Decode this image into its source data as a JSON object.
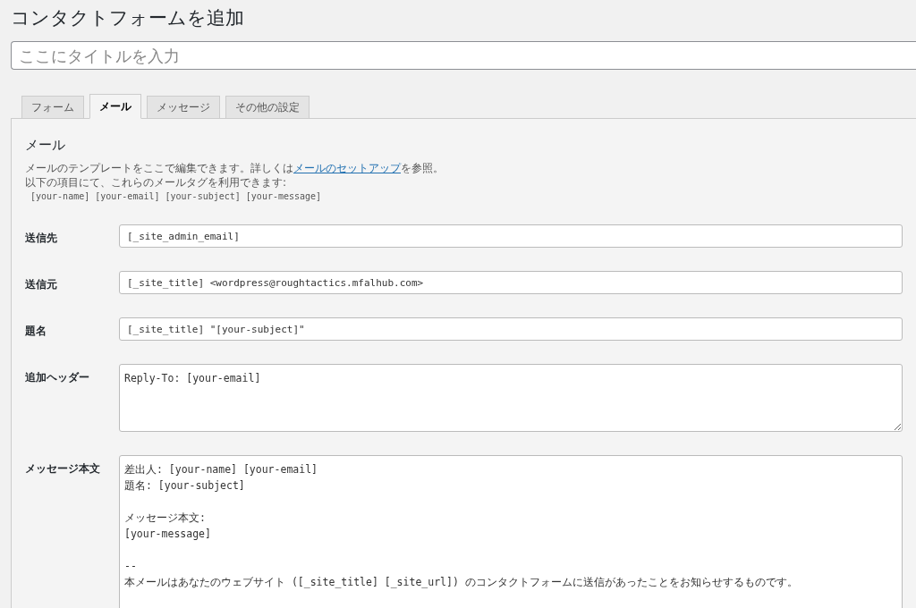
{
  "page_title": "コンタクトフォームを追加",
  "title_field": {
    "placeholder": "ここにタイトルを入力"
  },
  "tabs": [
    {
      "label": "フォーム",
      "selected": false
    },
    {
      "label": "メール",
      "selected": true
    },
    {
      "label": "メッセージ",
      "selected": false
    },
    {
      "label": "その他の設定",
      "selected": false
    }
  ],
  "section": {
    "heading": "メール",
    "description_before": "メールのテンプレートをここで編集できます。詳しくは",
    "link": "メールのセットアップ",
    "description_after": "を参照。",
    "tags_intro": "以下の項目にて、これらのメールタグを利用できます:",
    "tags": "[your-name] [your-email] [your-subject] [your-message]"
  },
  "fields": [
    {
      "kind": "input",
      "label": "送信先",
      "value": "[_site_admin_email]"
    },
    {
      "kind": "input",
      "label": "送信元",
      "value": "[_site_title] <wordpress@roughtactics.mfalhub.com>"
    },
    {
      "kind": "input",
      "label": "題名",
      "value": "[_site_title] \"[your-subject]\""
    },
    {
      "kind": "textarea",
      "label": "追加ヘッダー",
      "value": "Reply-To: [your-email]"
    },
    {
      "kind": "body",
      "label": "メッセージ本文",
      "value": "差出人: [your-name] [your-email]\n題名: [your-subject]\n\nメッセージ本文:\n[your-message]\n\n-- \n本メールはあなたのウェブサイト ([_site_title] [_site_url]) のコンタクトフォームに送信があったことをお知らせするものです。"
    }
  ]
}
